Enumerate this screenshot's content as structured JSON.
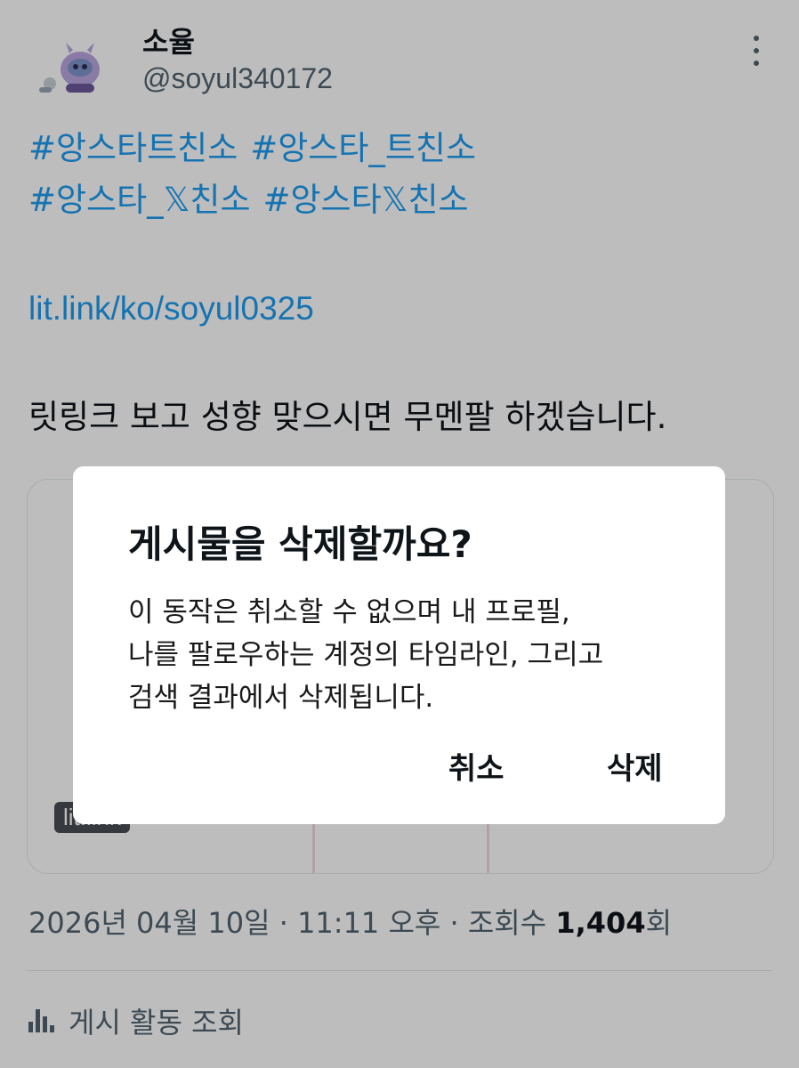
{
  "post": {
    "author": {
      "display_name": "소율",
      "handle": "@soyul340172"
    },
    "hashtags": [
      "#앙스타트친소",
      "#앙스타_트친소",
      "#앙스타_𝕏친소",
      "#앙스타𝕏친소"
    ],
    "link": "lit.link/ko/soyul0325",
    "message": "릿링크 보고 성향 맞으시면 무멘팔 하겠습니다.",
    "card_badge": "lit.link",
    "meta": {
      "date": "2026년 04월 10일",
      "separator": " · ",
      "time": "11:11 오후",
      "views_label": "조회수 ",
      "views_count": "1,404",
      "views_suffix": "회"
    },
    "activity_label": "게시 활동 조회"
  },
  "dialog": {
    "title": "게시물을 삭제할까요?",
    "body_lines": [
      "이 동작은 취소할 수 없으며 내 프로필,",
      "나를 팔로우하는 계정의 타임라인, 그리고",
      "검색 결과에서 삭제됩니다."
    ],
    "cancel_label": "취소",
    "delete_label": "삭제"
  },
  "colors": {
    "link": "#1d9bf0",
    "text_secondary": "#536471",
    "scrim": "rgba(0,0,0,0.26)"
  },
  "icons": [
    "more-vertical-icon",
    "bar-chart-icon"
  ]
}
